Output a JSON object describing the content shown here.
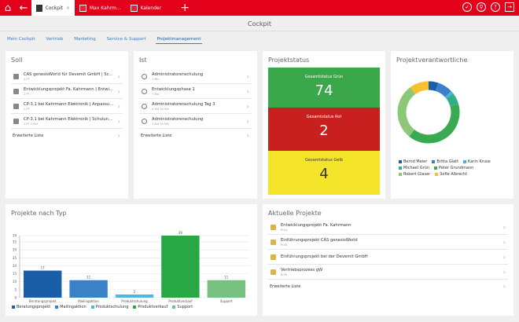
{
  "topbar": {
    "tabs": [
      {
        "label": "Cockpit",
        "close": "×"
      },
      {
        "label": "Max Kahrm..."
      },
      {
        "label": "Kalender"
      }
    ],
    "add": "+"
  },
  "header": {
    "title": "Cockpit"
  },
  "nav": [
    "Mein Cockpit",
    "Vertrieb",
    "Marketing",
    "Service & Support",
    "Projektmanagement"
  ],
  "soll": {
    "title": "Soll",
    "items": [
      {
        "t": "CAS genesisWorld für Devemit GmbH | Sch...",
        "s": "5 PT"
      },
      {
        "t": "Entwicklungsprojekt Fa. Kahrmann | Entwickl...",
        "s": "2 PT"
      },
      {
        "t": "CP-3.1 bei Kahrmann Elektronik | Anpassun...",
        "s": "2 PT"
      },
      {
        "t": "CP-3.1 bei Kahrmann Elektronik | Schulung ...",
        "s": "1 PT 5 Std"
      }
    ],
    "more": "Erweiterte Liste"
  },
  "ist": {
    "title": "Ist",
    "items": [
      {
        "t": "Administratorenschulung",
        "s": "1 Min"
      },
      {
        "t": "Entwicklungsphase 1",
        "s": "7 Std"
      },
      {
        "t": "Administratorenschulung Tag 3",
        "s": "6 Std 30 Min"
      },
      {
        "t": "Administratorenschulung",
        "s": "1 Std 30 Min"
      }
    ],
    "more": "Erweiterte Liste"
  },
  "status": {
    "title": "Projektstatus",
    "items": [
      {
        "label": "Gesamtstatus Grün",
        "value": "74",
        "color": "#3aa84a"
      },
      {
        "label": "Gesamtstatus Rot",
        "value": "2",
        "color": "#c8201e"
      },
      {
        "label": "Gesamtstatus Gelb",
        "value": "4",
        "color": "#f5e52a"
      }
    ]
  },
  "owners": {
    "title": "Projektverantwortliche",
    "items": [
      {
        "name": "Bernd Meier",
        "color": "#1a5ea8",
        "share": 5
      },
      {
        "name": "Britta Glatt",
        "color": "#3a82c8",
        "share": 8
      },
      {
        "name": "Karin Kruse",
        "color": "#4fb0e0",
        "share": 1.5
      },
      {
        "name": "Michael Grün",
        "color": "#34ad8a",
        "share": 6
      },
      {
        "name": "Peter Grundmann",
        "color": "#3aaa50",
        "share": 40
      },
      {
        "name": "Robert Glaser",
        "color": "#8cc878",
        "share": 29
      },
      {
        "name": "Sofie Albrecht",
        "color": "#f8bf2e",
        "share": 10
      }
    ]
  },
  "chart": {
    "title": "Projekte nach Typ",
    "ylim": [
      0,
      39
    ],
    "yticks": [
      0,
      5,
      10,
      15,
      20,
      25,
      30,
      35,
      39
    ],
    "categories": [
      "Beratungsprojekt",
      "Mailingaktion",
      "Produktschulung",
      "Produktverkauf",
      "Support"
    ],
    "values": [
      17,
      11,
      2,
      39,
      11
    ],
    "colors": [
      "#1a5ea8",
      "#3a82c8",
      "#4fb8e0",
      "#28a745",
      "#78c080"
    ]
  },
  "current": {
    "title": "Aktuelle Projekte",
    "items": [
      {
        "t": "Entwicklungsprojekt Fa. Kahrmann",
        "s": "Pr44"
      },
      {
        "t": "Einführungsprojekt CAS genesisWorld",
        "s": "Pr48"
      },
      {
        "t": "Einführungsprojekt bei der Devemit GmbH",
        "s": ""
      },
      {
        "t": "Vertriebsprozess gW",
        "s": "Pr39"
      }
    ],
    "more": "Erweiterte Liste"
  }
}
